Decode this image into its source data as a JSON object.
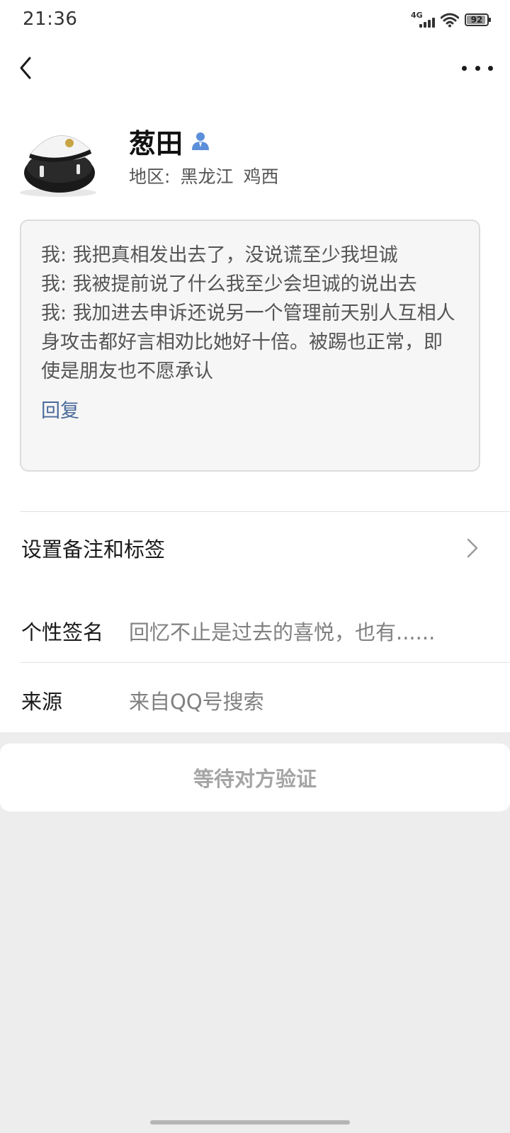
{
  "status_bar": {
    "time": "21:36",
    "network": "4G",
    "battery_level": "92",
    "battery_fraction": 0.92
  },
  "nav": {
    "back_icon": "chevron-left-icon",
    "more_icon": "more-horizontal-icon"
  },
  "profile": {
    "name": "葱田",
    "gender_icon": "male-person-icon",
    "region_label": "地区:",
    "region_province": "黑龙江",
    "region_city": "鸡西"
  },
  "message_box": {
    "lines": [
      "我: 我把真相发出去了，没说谎至少我坦诚",
      "我: 我被提前说了什么我至少会坦诚的说出去",
      "我: 我加进去申诉还说另一个管理前天别人互相人身攻击都好言相劝比她好十倍。被踢也正常，即使是朋友也不愿承认"
    ],
    "reply_label": "回复"
  },
  "settings": {
    "remark_label": "设置备注和标签"
  },
  "info": {
    "signature_label": "个性签名",
    "signature_value": "回忆不止是过去的喜悦，也有......",
    "source_label": "来源",
    "source_value": "来自QQ号搜索"
  },
  "action": {
    "verify_label": "等待对方验证"
  },
  "colors": {
    "link": "#4a6a9a",
    "gender_icon": "#5b8fd9",
    "background": "#ededed"
  }
}
